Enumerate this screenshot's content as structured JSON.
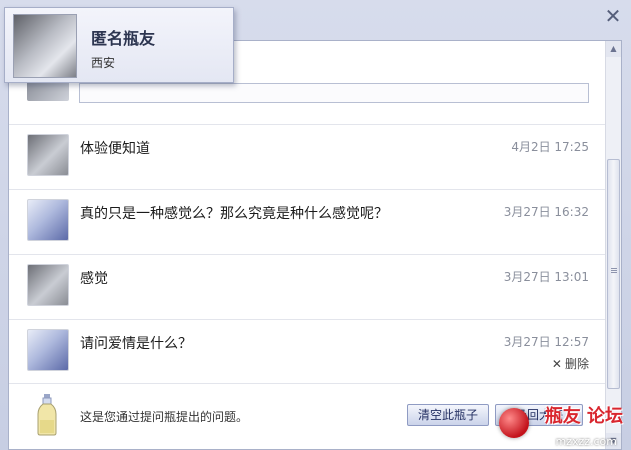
{
  "window": {
    "close_icon": "close-icon"
  },
  "profile": {
    "name": "匿名瓶友",
    "city": "西安",
    "avatar_icon": "user-avatar"
  },
  "messages": [
    {
      "text": "体验便知道",
      "time": "4月2日 17:25",
      "avatar_style": "a1",
      "show_delete": false
    },
    {
      "text": "真的只是一种感觉么？那么究竟是种什么感觉呢？",
      "time": "3月27日 16:32",
      "avatar_style": "a2",
      "show_delete": false
    },
    {
      "text": "感觉",
      "time": "3月27日 13:01",
      "avatar_style": "a1",
      "show_delete": false
    },
    {
      "text": "请问爱情是什么？",
      "time": "3月27日 12:57",
      "avatar_style": "a2",
      "show_delete": true
    }
  ],
  "delete_label": "删除",
  "footer": {
    "note": "这是您通过提问瓶提出的问题。",
    "clear_button": "清空此瓶子",
    "throw_button": "扔回大海",
    "bottle_icon": "bottle-icon"
  },
  "watermark": {
    "logo": "瓶友 论坛",
    "url": "mzxzz.com"
  }
}
